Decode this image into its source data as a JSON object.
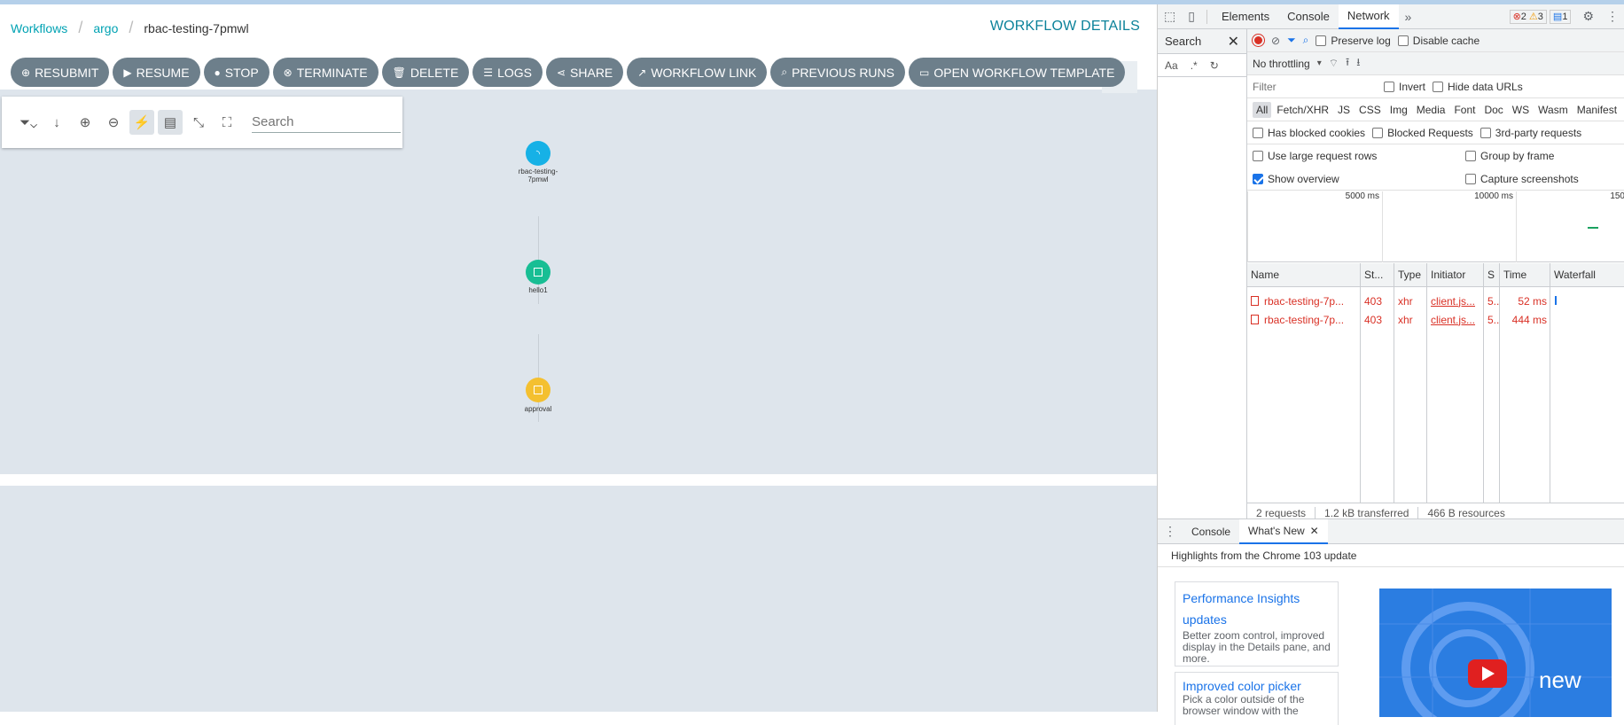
{
  "breadcrumb": {
    "items": [
      "Workflows",
      "argo"
    ],
    "current": "rbac-testing-7pmwl"
  },
  "page_title": "WORKFLOW DETAILS",
  "actions": [
    {
      "label": "RESUBMIT",
      "icon": "plus-circle-icon"
    },
    {
      "label": "RESUME",
      "icon": "play-icon"
    },
    {
      "label": "STOP",
      "icon": "stop-circle-icon"
    },
    {
      "label": "TERMINATE",
      "icon": "times-circle-icon"
    },
    {
      "label": "DELETE",
      "icon": "trash-icon"
    },
    {
      "label": "LOGS",
      "icon": "bars-icon"
    },
    {
      "label": "SHARE",
      "icon": "share-icon"
    },
    {
      "label": "WORKFLOW LINK",
      "icon": "external-link-icon"
    },
    {
      "label": "PREVIOUS RUNS",
      "icon": "search-icon"
    },
    {
      "label": "OPEN WORKFLOW TEMPLATE",
      "icon": "window-icon"
    }
  ],
  "graph": {
    "search_placeholder": "Search",
    "nodes": [
      {
        "label": "rbac-testing-7pmwl",
        "status": "running",
        "color": "#16b1e6"
      },
      {
        "label": "hello1",
        "status": "succeeded",
        "color": "#18be94"
      },
      {
        "label": "approval",
        "status": "pending",
        "color": "#f4c030"
      }
    ]
  },
  "devtools": {
    "tabs": [
      "Elements",
      "Console",
      "Network"
    ],
    "selected_tab": "Network",
    "errors": "2",
    "warnings": "3",
    "messages": "1",
    "search_title": "Search",
    "search_tools": [
      "Aa",
      ".*"
    ],
    "preserve_log": "Preserve log",
    "disable_cache": "Disable cache",
    "throttling": "No throttling",
    "filter_placeholder": "Filter",
    "invert": "Invert",
    "hide_data_urls": "Hide data URLs",
    "types": [
      "All",
      "Fetch/XHR",
      "JS",
      "CSS",
      "Img",
      "Media",
      "Font",
      "Doc",
      "WS",
      "Wasm",
      "Manifest"
    ],
    "has_blocked_cookies": "Has blocked cookies",
    "blocked_requests": "Blocked Requests",
    "third_party": "3rd-party requests",
    "large_rows": "Use large request rows",
    "group_by_frame": "Group by frame",
    "show_overview": "Show overview",
    "capture_screenshots": "Capture screenshots",
    "overview_ticks": [
      "5000 ms",
      "10000 ms",
      "150"
    ],
    "columns": [
      "Name",
      "St...",
      "Type",
      "Initiator",
      "S",
      "Time",
      "Waterfall"
    ],
    "requests": [
      {
        "name": "rbac-testing-7p...",
        "status": "403",
        "type": "xhr",
        "initiator": "client.js...",
        "size": "5...",
        "time": "52 ms"
      },
      {
        "name": "rbac-testing-7p...",
        "status": "403",
        "type": "xhr",
        "initiator": "client.js...",
        "size": "5...",
        "time": "444 ms"
      }
    ],
    "status_bar": [
      "2 requests",
      "1.2 kB transferred",
      "466 B resources"
    ],
    "drawer_tabs": [
      "Console",
      "What's New"
    ],
    "whats_new_heading": "Highlights from the Chrome 103 update",
    "cards": [
      {
        "title": "Performance Insights updates",
        "desc": "Better zoom control, improved display in the Details pane, and more."
      },
      {
        "title": "Improved color picker",
        "desc": "Pick a color outside of the browser window with the"
      }
    ],
    "promo_text": "new"
  }
}
